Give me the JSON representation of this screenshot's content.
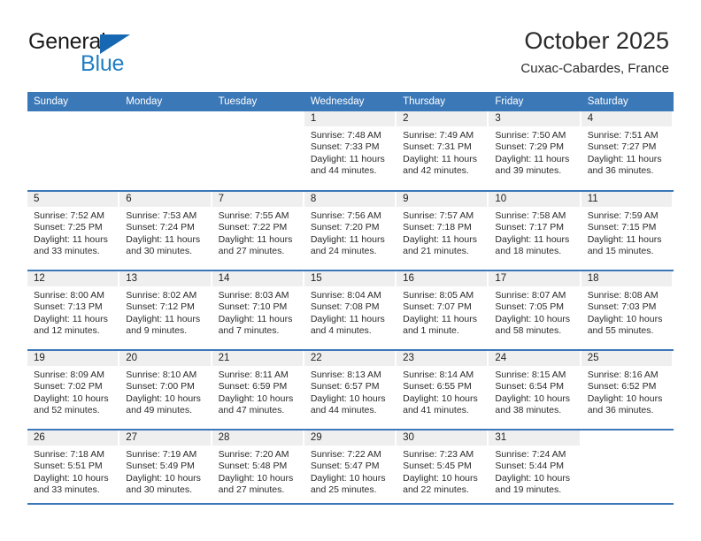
{
  "brand": {
    "name_part1": "General",
    "name_part2": "Blue",
    "triangle_icon": "blue-triangle-icon",
    "accent_color": "#1668b3",
    "blue_text_color": "#1f7ec4"
  },
  "header": {
    "title": "October 2025",
    "subtitle": "Cuxac-Cabardes, France"
  },
  "theme": {
    "header_row_bg": "#3b78b8",
    "daynum_band_bg": "#efefef",
    "row_divider": "#3b78b8",
    "page_bg": "#ffffff",
    "text_color": "#2a2a2a"
  },
  "calendar": {
    "weekday_headers": [
      "Sunday",
      "Monday",
      "Tuesday",
      "Wednesday",
      "Thursday",
      "Friday",
      "Saturday"
    ],
    "labels": {
      "sunrise_prefix": "Sunrise:",
      "sunset_prefix": "Sunset:",
      "daylight_prefix": "Daylight:"
    },
    "weeks": [
      [
        {
          "day": "",
          "sunrise": "",
          "sunset": "",
          "daylight": "",
          "blank": true
        },
        {
          "day": "",
          "sunrise": "",
          "sunset": "",
          "daylight": "",
          "blank": true
        },
        {
          "day": "",
          "sunrise": "",
          "sunset": "",
          "daylight": "",
          "blank": true
        },
        {
          "day": "1",
          "sunrise": "Sunrise: 7:48 AM",
          "sunset": "Sunset: 7:33 PM",
          "daylight": "Daylight: 11 hours and 44 minutes."
        },
        {
          "day": "2",
          "sunrise": "Sunrise: 7:49 AM",
          "sunset": "Sunset: 7:31 PM",
          "daylight": "Daylight: 11 hours and 42 minutes."
        },
        {
          "day": "3",
          "sunrise": "Sunrise: 7:50 AM",
          "sunset": "Sunset: 7:29 PM",
          "daylight": "Daylight: 11 hours and 39 minutes."
        },
        {
          "day": "4",
          "sunrise": "Sunrise: 7:51 AM",
          "sunset": "Sunset: 7:27 PM",
          "daylight": "Daylight: 11 hours and 36 minutes."
        }
      ],
      [
        {
          "day": "5",
          "sunrise": "Sunrise: 7:52 AM",
          "sunset": "Sunset: 7:25 PM",
          "daylight": "Daylight: 11 hours and 33 minutes."
        },
        {
          "day": "6",
          "sunrise": "Sunrise: 7:53 AM",
          "sunset": "Sunset: 7:24 PM",
          "daylight": "Daylight: 11 hours and 30 minutes."
        },
        {
          "day": "7",
          "sunrise": "Sunrise: 7:55 AM",
          "sunset": "Sunset: 7:22 PM",
          "daylight": "Daylight: 11 hours and 27 minutes."
        },
        {
          "day": "8",
          "sunrise": "Sunrise: 7:56 AM",
          "sunset": "Sunset: 7:20 PM",
          "daylight": "Daylight: 11 hours and 24 minutes."
        },
        {
          "day": "9",
          "sunrise": "Sunrise: 7:57 AM",
          "sunset": "Sunset: 7:18 PM",
          "daylight": "Daylight: 11 hours and 21 minutes."
        },
        {
          "day": "10",
          "sunrise": "Sunrise: 7:58 AM",
          "sunset": "Sunset: 7:17 PM",
          "daylight": "Daylight: 11 hours and 18 minutes."
        },
        {
          "day": "11",
          "sunrise": "Sunrise: 7:59 AM",
          "sunset": "Sunset: 7:15 PM",
          "daylight": "Daylight: 11 hours and 15 minutes."
        }
      ],
      [
        {
          "day": "12",
          "sunrise": "Sunrise: 8:00 AM",
          "sunset": "Sunset: 7:13 PM",
          "daylight": "Daylight: 11 hours and 12 minutes."
        },
        {
          "day": "13",
          "sunrise": "Sunrise: 8:02 AM",
          "sunset": "Sunset: 7:12 PM",
          "daylight": "Daylight: 11 hours and 9 minutes."
        },
        {
          "day": "14",
          "sunrise": "Sunrise: 8:03 AM",
          "sunset": "Sunset: 7:10 PM",
          "daylight": "Daylight: 11 hours and 7 minutes."
        },
        {
          "day": "15",
          "sunrise": "Sunrise: 8:04 AM",
          "sunset": "Sunset: 7:08 PM",
          "daylight": "Daylight: 11 hours and 4 minutes."
        },
        {
          "day": "16",
          "sunrise": "Sunrise: 8:05 AM",
          "sunset": "Sunset: 7:07 PM",
          "daylight": "Daylight: 11 hours and 1 minute."
        },
        {
          "day": "17",
          "sunrise": "Sunrise: 8:07 AM",
          "sunset": "Sunset: 7:05 PM",
          "daylight": "Daylight: 10 hours and 58 minutes."
        },
        {
          "day": "18",
          "sunrise": "Sunrise: 8:08 AM",
          "sunset": "Sunset: 7:03 PM",
          "daylight": "Daylight: 10 hours and 55 minutes."
        }
      ],
      [
        {
          "day": "19",
          "sunrise": "Sunrise: 8:09 AM",
          "sunset": "Sunset: 7:02 PM",
          "daylight": "Daylight: 10 hours and 52 minutes."
        },
        {
          "day": "20",
          "sunrise": "Sunrise: 8:10 AM",
          "sunset": "Sunset: 7:00 PM",
          "daylight": "Daylight: 10 hours and 49 minutes."
        },
        {
          "day": "21",
          "sunrise": "Sunrise: 8:11 AM",
          "sunset": "Sunset: 6:59 PM",
          "daylight": "Daylight: 10 hours and 47 minutes."
        },
        {
          "day": "22",
          "sunrise": "Sunrise: 8:13 AM",
          "sunset": "Sunset: 6:57 PM",
          "daylight": "Daylight: 10 hours and 44 minutes."
        },
        {
          "day": "23",
          "sunrise": "Sunrise: 8:14 AM",
          "sunset": "Sunset: 6:55 PM",
          "daylight": "Daylight: 10 hours and 41 minutes."
        },
        {
          "day": "24",
          "sunrise": "Sunrise: 8:15 AM",
          "sunset": "Sunset: 6:54 PM",
          "daylight": "Daylight: 10 hours and 38 minutes."
        },
        {
          "day": "25",
          "sunrise": "Sunrise: 8:16 AM",
          "sunset": "Sunset: 6:52 PM",
          "daylight": "Daylight: 10 hours and 36 minutes."
        }
      ],
      [
        {
          "day": "26",
          "sunrise": "Sunrise: 7:18 AM",
          "sunset": "Sunset: 5:51 PM",
          "daylight": "Daylight: 10 hours and 33 minutes."
        },
        {
          "day": "27",
          "sunrise": "Sunrise: 7:19 AM",
          "sunset": "Sunset: 5:49 PM",
          "daylight": "Daylight: 10 hours and 30 minutes."
        },
        {
          "day": "28",
          "sunrise": "Sunrise: 7:20 AM",
          "sunset": "Sunset: 5:48 PM",
          "daylight": "Daylight: 10 hours and 27 minutes."
        },
        {
          "day": "29",
          "sunrise": "Sunrise: 7:22 AM",
          "sunset": "Sunset: 5:47 PM",
          "daylight": "Daylight: 10 hours and 25 minutes."
        },
        {
          "day": "30",
          "sunrise": "Sunrise: 7:23 AM",
          "sunset": "Sunset: 5:45 PM",
          "daylight": "Daylight: 10 hours and 22 minutes."
        },
        {
          "day": "31",
          "sunrise": "Sunrise: 7:24 AM",
          "sunset": "Sunset: 5:44 PM",
          "daylight": "Daylight: 10 hours and 19 minutes."
        },
        {
          "day": "",
          "sunrise": "",
          "sunset": "",
          "daylight": "",
          "blank": true
        }
      ]
    ]
  }
}
